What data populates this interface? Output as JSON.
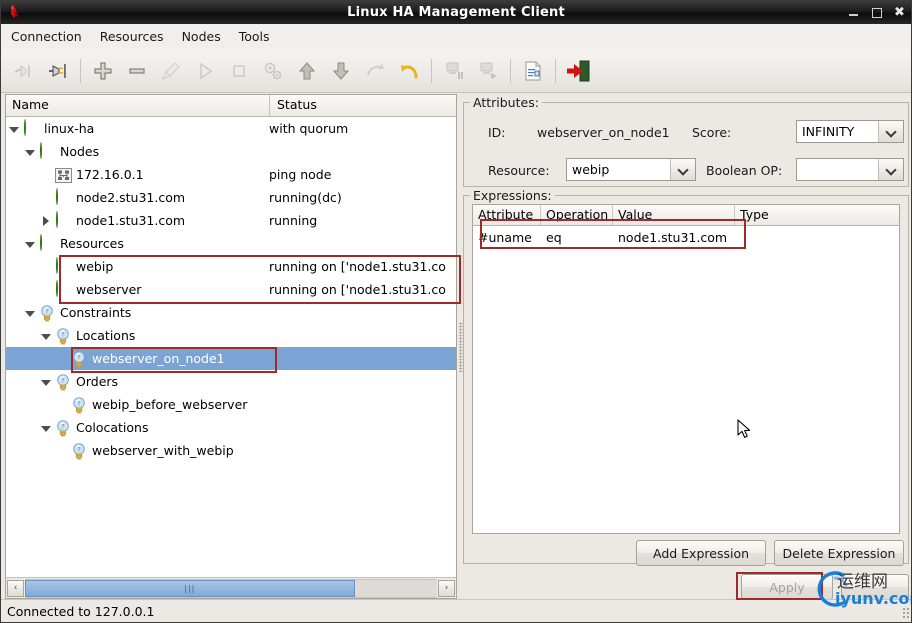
{
  "window": {
    "title": "Linux HA Management Client",
    "icon": "app-logo-icon",
    "controls": {
      "minimize": "_",
      "maximize": "□",
      "close": "✕"
    }
  },
  "menubar": {
    "items": [
      {
        "label": "Connection",
        "name": "menu-connection"
      },
      {
        "label": "Resources",
        "name": "menu-resources"
      },
      {
        "label": "Nodes",
        "name": "menu-nodes"
      },
      {
        "label": "Tools",
        "name": "menu-tools"
      }
    ]
  },
  "toolbar": {
    "buttons": [
      {
        "name": "disconnect-icon",
        "enabled": false
      },
      {
        "name": "connect-icon",
        "enabled": true
      },
      {
        "name": "add-icon",
        "enabled": true
      },
      {
        "name": "remove-icon",
        "enabled": true
      },
      {
        "name": "cleanup-icon",
        "enabled": false
      },
      {
        "name": "start-icon",
        "enabled": false
      },
      {
        "name": "stop-icon",
        "enabled": false
      },
      {
        "name": "manage-icon",
        "enabled": false
      },
      {
        "name": "move-up-icon",
        "enabled": true
      },
      {
        "name": "move-down-icon",
        "enabled": true
      },
      {
        "name": "migrate-icon",
        "enabled": false
      },
      {
        "name": "undo-icon",
        "enabled": true
      },
      {
        "name": "standby-icon",
        "enabled": false
      },
      {
        "name": "online-icon",
        "enabled": false
      },
      {
        "name": "cib-document-icon",
        "enabled": true
      },
      {
        "name": "quit-icon",
        "enabled": true
      }
    ]
  },
  "tree": {
    "columns": {
      "name": "Name",
      "status": "Status"
    },
    "rows": [
      {
        "indent": 0,
        "twisty": "open",
        "icon": "green-status-icon",
        "label": "linux-ha",
        "status": "with quorum",
        "name": "tree-item-linux-ha"
      },
      {
        "indent": 1,
        "twisty": "open",
        "icon": "green-status-icon",
        "label": "Nodes",
        "status": "",
        "name": "tree-item-nodes"
      },
      {
        "indent": 2,
        "twisty": "none",
        "icon": "network-node-icon",
        "label": "172.16.0.1",
        "status": "ping node",
        "name": "tree-item-172-16-0-1"
      },
      {
        "indent": 2,
        "twisty": "none",
        "icon": "green-status-icon",
        "label": "node2.stu31.com",
        "status": "running(dc)",
        "name": "tree-item-node2"
      },
      {
        "indent": 2,
        "twisty": "closed",
        "icon": "green-status-icon",
        "label": "node1.stu31.com",
        "status": "running",
        "name": "tree-item-node1"
      },
      {
        "indent": 1,
        "twisty": "open",
        "icon": "green-status-icon",
        "label": "Resources",
        "status": "",
        "name": "tree-item-resources"
      },
      {
        "indent": 2,
        "twisty": "none",
        "icon": "green-status-icon",
        "label": "webip",
        "status": "running on ['node1.stu31.co",
        "name": "tree-item-webip"
      },
      {
        "indent": 2,
        "twisty": "none",
        "icon": "green-status-icon",
        "label": "webserver",
        "status": "running on ['node1.stu31.co",
        "name": "tree-item-webserver"
      },
      {
        "indent": 1,
        "twisty": "open",
        "icon": "bulb-icon",
        "label": "Constraints",
        "status": "",
        "name": "tree-item-constraints"
      },
      {
        "indent": 2,
        "twisty": "open",
        "icon": "bulb-icon",
        "label": "Locations",
        "status": "",
        "name": "tree-item-locations"
      },
      {
        "indent": 3,
        "twisty": "none",
        "icon": "bulb-icon",
        "label": "webserver_on_node1",
        "status": "",
        "selected": true,
        "name": "tree-item-webserver-on-node1"
      },
      {
        "indent": 2,
        "twisty": "open",
        "icon": "bulb-icon",
        "label": "Orders",
        "status": "",
        "name": "tree-item-orders"
      },
      {
        "indent": 3,
        "twisty": "none",
        "icon": "bulb-icon",
        "label": "webip_before_webserver",
        "status": "",
        "name": "tree-item-webip-before-webserver"
      },
      {
        "indent": 2,
        "twisty": "open",
        "icon": "bulb-icon",
        "label": "Colocations",
        "status": "",
        "name": "tree-item-colocations"
      },
      {
        "indent": 3,
        "twisty": "none",
        "icon": "bulb-icon",
        "label": "webserver_with_webip",
        "status": "",
        "name": "tree-item-webserver-with-webip"
      }
    ],
    "hscroll": {
      "left_arrow": "‹",
      "right_arrow": "›",
      "thumb_grip": "⋮⋮"
    }
  },
  "attributes": {
    "legend": "Attributes:",
    "id_label": "ID:",
    "id_value": "webserver_on_node1",
    "score_label": "Score:",
    "score_value": "INFINITY",
    "resource_label": "Resource:",
    "resource_value": "webip",
    "boolean_label": "Boolean OP:",
    "boolean_value": ""
  },
  "expressions": {
    "legend": "Expressions:",
    "columns": [
      "Attribute",
      "Operation",
      "Value",
      "Type"
    ],
    "rows": [
      {
        "attribute": "#uname",
        "operation": "eq",
        "value": "node1.stu31.com",
        "type": ""
      }
    ],
    "add_button": "Add Expression",
    "delete_button": "Delete Expression"
  },
  "actions": {
    "apply_button": "Apply"
  },
  "statusbar": {
    "text": "Connected to 127.0.0.1"
  },
  "watermark": {
    "cn": "运维网",
    "en": "iyunv.com"
  },
  "colors": {
    "accent_selection": "#7ba4d4",
    "annotation": "#9e2a2a",
    "status_green": "#6fce2f",
    "watermark_blue": "#1a7fd4",
    "titlebar": "#1b1b1b"
  }
}
